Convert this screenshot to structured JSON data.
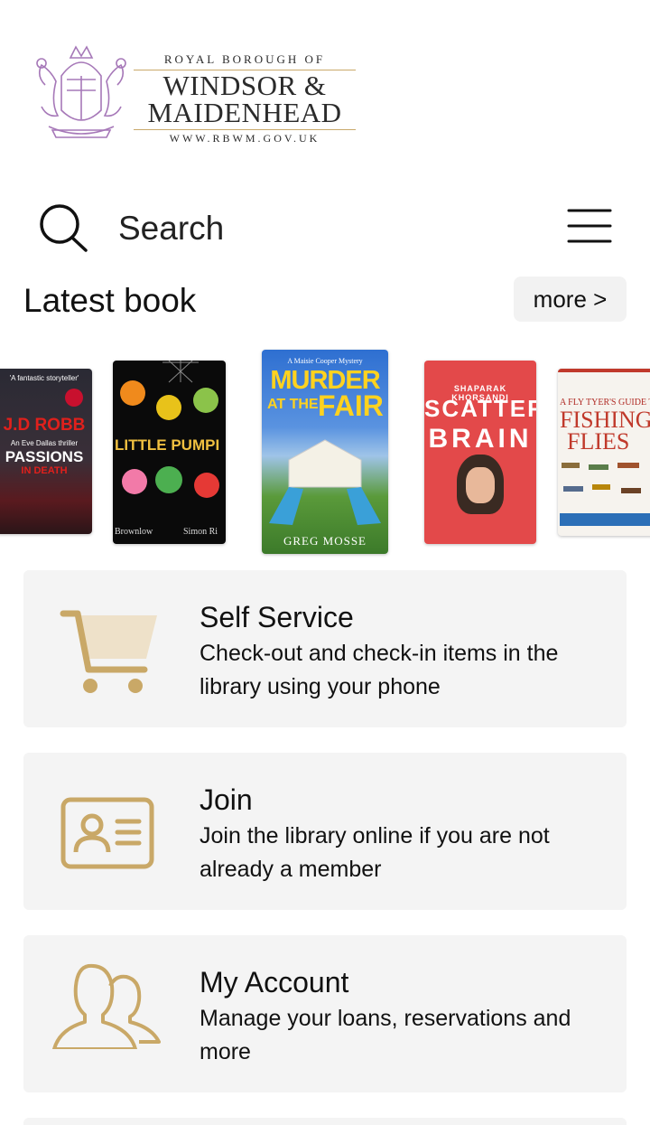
{
  "header": {
    "royal": "ROYAL BOROUGH OF",
    "line1": "WINDSOR &",
    "line2": "MAIDENHEAD",
    "website": "WWW.RBWM.GOV.UK",
    "logo_icon": "borough-crest-icon"
  },
  "search": {
    "label": "Search",
    "icon": "search-icon"
  },
  "menu": {
    "icon": "hamburger-menu-icon"
  },
  "latest": {
    "title": "Latest book",
    "more_label": "more >",
    "books": [
      {
        "author": "J.D ROBB",
        "subtitle": "An Eve Dallas thriller",
        "title": "PASSIONS",
        "title2": "IN DEATH",
        "quote": "'A fantastic storyteller'"
      },
      {
        "title": "LITTLE PUMPI",
        "author": "Brownlow",
        "author2": "Simon Ri"
      },
      {
        "series": "A Maisie Cooper Mystery",
        "title1": "MURDER",
        "title2": "AT THE",
        "title3": "FAIR",
        "author": "GREG MOSSE"
      },
      {
        "author": "SHAPARAK KHORSANDI",
        "title1": "SCATTER",
        "title2": "BRAIN"
      },
      {
        "title1": "A FLY TYER'S GUIDE TO",
        "title2": "FISHING",
        "title3": "FLIES"
      }
    ]
  },
  "cards": [
    {
      "title": "Self Service",
      "desc": "Check-out and check-in items in the library using your phone",
      "icon": "shopping-cart-icon"
    },
    {
      "title": "Join",
      "desc": "Join the library online if you are not already a member",
      "icon": "id-card-icon"
    },
    {
      "title": "My Account",
      "desc": "Manage your loans, reservations and more",
      "icon": "users-icon"
    }
  ],
  "colors": {
    "accent_gold": "#c9a867",
    "crest_purple": "#a678b8",
    "card_bg": "#f4f4f4"
  }
}
